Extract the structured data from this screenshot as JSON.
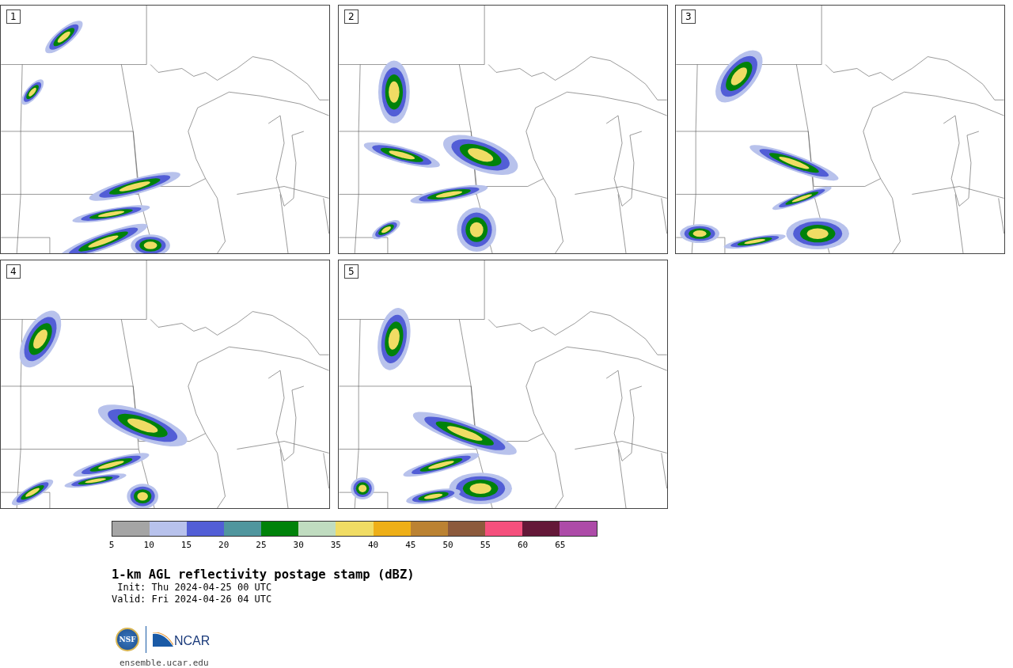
{
  "panels": [
    {
      "label": "1"
    },
    {
      "label": "2"
    },
    {
      "label": "3"
    },
    {
      "label": "4"
    },
    {
      "label": "5"
    }
  ],
  "colorbar": {
    "bins": [
      {
        "color": "#a5a5a5"
      },
      {
        "color": "#b8c2ec"
      },
      {
        "color": "#525ed6"
      },
      {
        "color": "#50969e"
      },
      {
        "color": "#00820a"
      },
      {
        "color": "#c0dcc0"
      },
      {
        "color": "#f0dc64"
      },
      {
        "color": "#eeaf17"
      },
      {
        "color": "#bb8232"
      },
      {
        "color": "#8c5a3c"
      },
      {
        "color": "#f5507d"
      },
      {
        "color": "#641838"
      },
      {
        "color": "#ad4ba8"
      }
    ],
    "ticks": [
      "5",
      "10",
      "15",
      "20",
      "25",
      "30",
      "35",
      "40",
      "45",
      "50",
      "55",
      "60",
      "65"
    ]
  },
  "title": "1-km AGL reflectivity postage stamp (dBZ)",
  "init": " Init: Thu 2024-04-25 00 UTC",
  "valid": "Valid: Fri 2024-04-26 04 UTC",
  "logos": {
    "nsf": "NSF",
    "ncar": "NCAR"
  },
  "url": "ensemble.ucar.edu"
}
